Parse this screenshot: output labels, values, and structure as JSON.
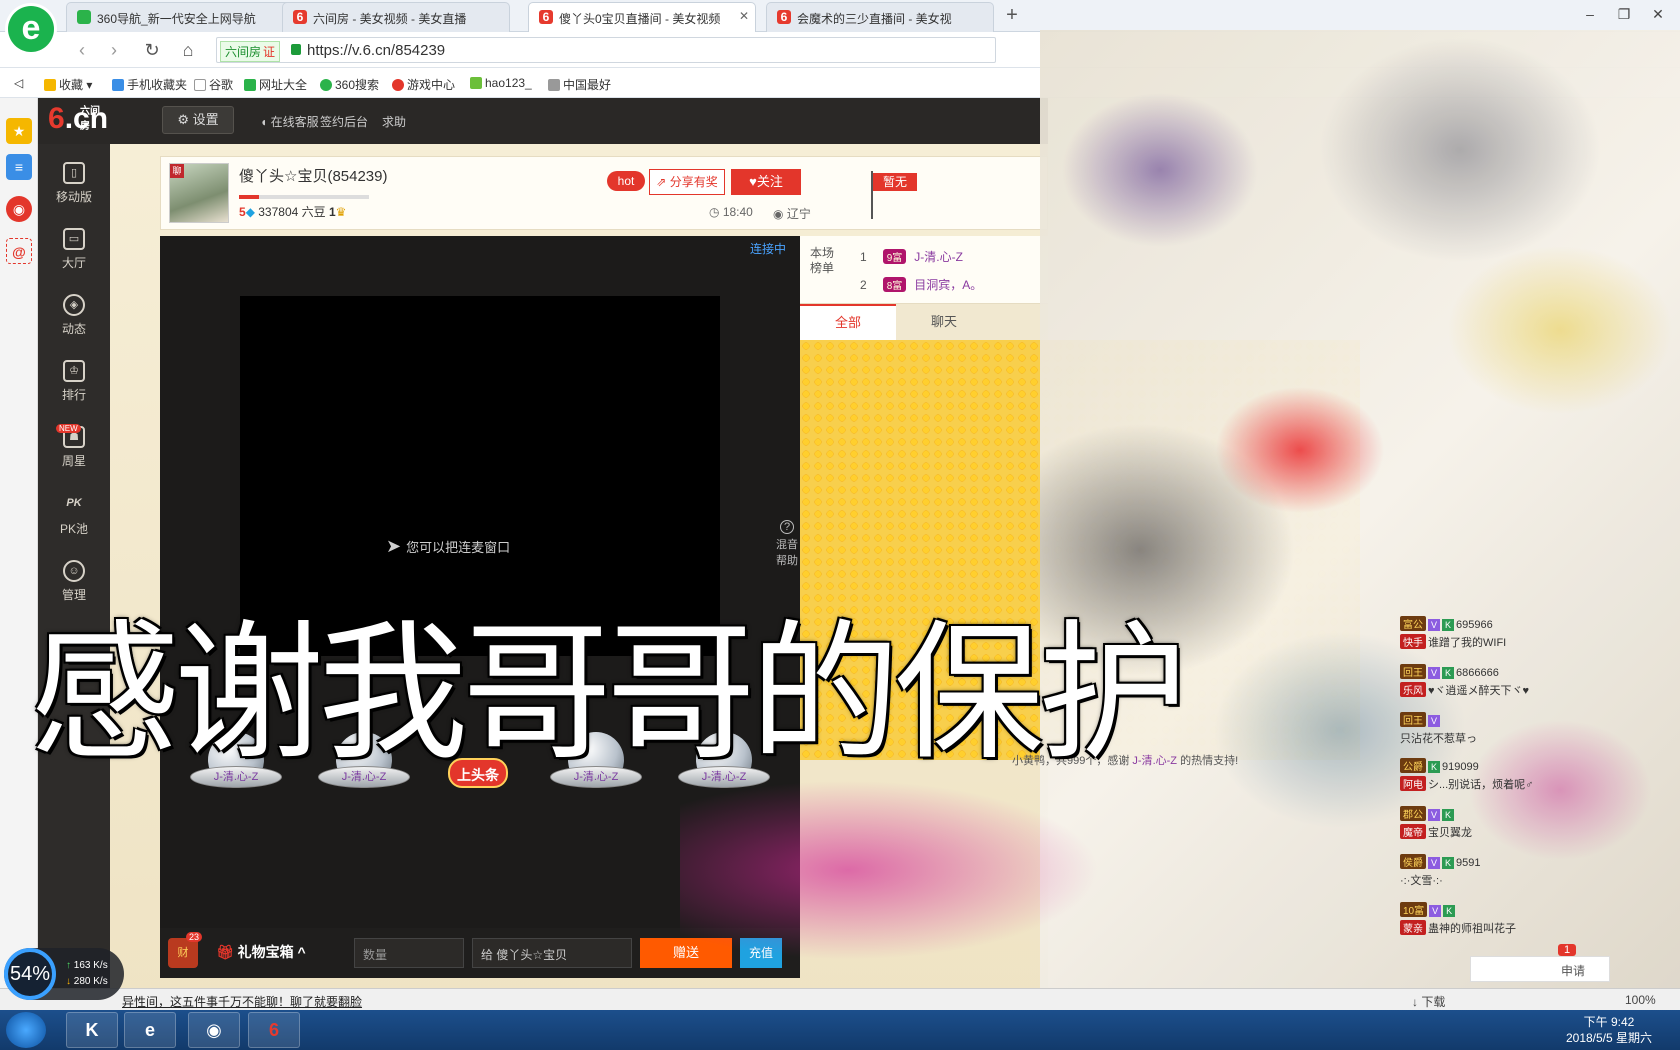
{
  "browser": {
    "logo": "e",
    "tabs": [
      {
        "title": "360导航_新一代安全上网导航",
        "fav": "360"
      },
      {
        "title": "六间房 - 美女视频 - 美女直播",
        "fav": "6"
      },
      {
        "title": "傻丫头0宝贝直播间 - 美女视频",
        "fav": "6"
      },
      {
        "title": "会魔术的三少直播间 - 美女视",
        "fav": "6"
      }
    ],
    "new_tab": "+",
    "site_tag": "六间房",
    "site_tag_badge": "证",
    "url": "https://v.6.cn/854239",
    "bookmarks": [
      "收藏",
      "手机收藏夹",
      "谷歌",
      "网址大全",
      "360搜索",
      "游戏中心",
      "hao123_",
      "中国最好"
    ]
  },
  "site": {
    "logo_six": "6",
    "logo_cn": ".cn",
    "logo_sub": "六间房",
    "settings": "设置",
    "top_links": [
      "在线客服",
      "签约后台",
      "求助"
    ],
    "nav": [
      {
        "label": "移动版",
        "icon": "phone-icon"
      },
      {
        "label": "大厅",
        "icon": "tv-icon"
      },
      {
        "label": "动态",
        "icon": "compass-icon"
      },
      {
        "label": "排行",
        "icon": "crown-icon"
      },
      {
        "label": "周星",
        "icon": "gift-icon"
      },
      {
        "label": "PK池",
        "icon": "pk-icon"
      },
      {
        "label": "管理",
        "icon": "manage-icon"
      }
    ],
    "new_badge": "NEW"
  },
  "anchor": {
    "chat_tag": "聊",
    "name": "傻丫头☆宝贝(854239)",
    "level": "5",
    "beans": "337804 六豆",
    "badge_level": "1",
    "hot": "hot",
    "share": "分享有奖",
    "follow": "关注",
    "time": "18:40",
    "location": "辽宁",
    "flag": "暂无"
  },
  "video": {
    "status": "连接中",
    "hint": "您可以把连麦窗口",
    "mix_help": "混音帮助",
    "gift_slots": [
      "J-清.心-Z",
      "J-清.心-Z",
      "上头条",
      "J-清.心-Z",
      "J-清.心-Z"
    ]
  },
  "gift_bar": {
    "wealth": "财",
    "wealth_count": "23",
    "gift_box": "礼物宝箱",
    "qty_placeholder": "数量",
    "to": "给 傻丫头☆宝贝",
    "send": "赠送",
    "recharge": "充值"
  },
  "rank": {
    "title": "本场榜单",
    "rows": [
      {
        "rank": "1",
        "level": "9富",
        "name": "J-清.心-Z"
      },
      {
        "rank": "2",
        "level": "8富",
        "name": "目洞宾，A。"
      }
    ]
  },
  "chat": {
    "tabs": [
      "全部",
      "聊天"
    ],
    "thanks_prefix": "小黄鸭，共999个，感谢",
    "thanks_user": "J-清.心-Z",
    "thanks_suffix": "的热情支持!",
    "lines": [
      {
        "badge": "富公",
        "id": "695966",
        "msg_badge": "快手",
        "msg": "谁蹭了我的WIFI"
      },
      {
        "badge": "回王",
        "id": "6866666",
        "msg_badge": "乐风",
        "msg": "♥ヾ逍遥メ醉天下ヾ♥"
      },
      {
        "badge": "回王",
        "id": "",
        "msg_badge": "",
        "msg": "只沾花不惹草っ"
      },
      {
        "badge": "公爵",
        "id": "919099",
        "msg_badge": "阿电",
        "msg": "シ...别说话，烦着呢♂"
      },
      {
        "badge": "郡公",
        "id": "",
        "msg_badge": "魔帝",
        "msg": "宝贝翼龙"
      },
      {
        "badge": "侯爵",
        "id": "9591",
        "msg_badge": "",
        "msg": "·:·文雪·:·"
      },
      {
        "badge": "10富",
        "id": "",
        "msg_badge": "蒙亲",
        "msg": "蛊神的师祖叫花子"
      }
    ],
    "apply": "申请",
    "apply_badge": "1"
  },
  "caption": "感谢我哥哥的保护",
  "status": {
    "text": "异性间，这五件事千万不能聊！聊了就要翻脸",
    "download": "下载",
    "zoom": "100%"
  },
  "net": {
    "percent": "54%",
    "up": "163 K/s",
    "down": "280 K/s"
  },
  "taskbar": {
    "time": "下午 9:42",
    "date": "2018/5/5 星期六"
  }
}
